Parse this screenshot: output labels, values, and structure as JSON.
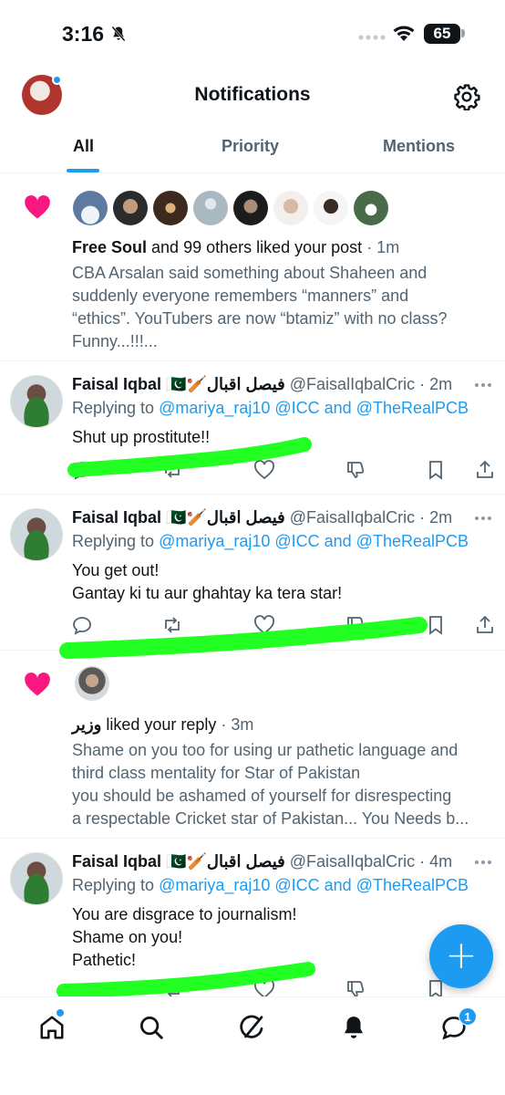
{
  "status_bar": {
    "time": "3:16",
    "battery": "65"
  },
  "header": {
    "title": "Notifications"
  },
  "tabs": [
    {
      "label": "All",
      "active": true
    },
    {
      "label": "Priority",
      "active": false
    },
    {
      "label": "Mentions",
      "active": false
    }
  ],
  "notifications": [
    {
      "type": "like",
      "actor": "Free Soul",
      "action": " and 99 others liked your post",
      "time": " · 1m",
      "text_lines": [
        "CBA Arsalan said something about Shaheen and",
        "suddenly everyone remembers “manners” and",
        "“ethics”. YouTubers are now “btamiz” with no class?",
        "Funny...!!!..."
      ]
    },
    {
      "type": "reply",
      "name": "Faisal Iqbal",
      "name_urdu": "فیصل اقبال",
      "handle": "@FaisalIqbalCric",
      "time": " · 2m",
      "replying_prefix": "Replying to ",
      "replying_to": "@mariya_raj10 @ICC and @TheRealPCB",
      "text_lines": [
        "Shut up prostitute!!"
      ]
    },
    {
      "type": "reply",
      "name": "Faisal Iqbal",
      "name_urdu": "فیصل اقبال",
      "handle": "@FaisalIqbalCric",
      "time": " · 2m",
      "replying_prefix": "Replying to ",
      "replying_to": "@mariya_raj10 @ICC and @TheRealPCB",
      "text_lines": [
        "You get out!",
        "Gantay ki tu aur ghahtay ka tera star!"
      ]
    },
    {
      "type": "like",
      "actor": "وزیر",
      "action": " liked your reply",
      "time": " · 3m",
      "text_lines": [
        "Shame on you too for using ur pathetic language and",
        "third class mentality for Star of Pakistan",
        "you should be ashamed of yourself for disrespecting",
        "a respectable Cricket star of Pakistan... You Needs b..."
      ]
    },
    {
      "type": "reply",
      "name": "Faisal Iqbal",
      "name_urdu": "فیصل اقبال",
      "handle": "@FaisalIqbalCric",
      "time": " · 4m",
      "replying_prefix": "Replying to ",
      "replying_to": "@mariya_raj10 @ICC and @TheRealPCB",
      "text_lines": [
        "You are disgrace to journalism!",
        "Shame on you!",
        "Pathetic!"
      ]
    }
  ],
  "bottom_nav": {
    "messages_badge": "1"
  },
  "colors": {
    "accent": "#1d9bf0",
    "like": "#f91880",
    "muted": "#536471",
    "scribble": "#22ff22"
  },
  "icons": [
    "bell-slash-icon",
    "gear-icon",
    "heart-icon",
    "more-icon",
    "reply-icon",
    "retweet-icon",
    "like-icon",
    "dislike-icon",
    "bookmark-icon",
    "share-icon",
    "home-icon",
    "search-icon",
    "grok-icon",
    "bell-icon",
    "messages-icon",
    "plus-icon"
  ]
}
